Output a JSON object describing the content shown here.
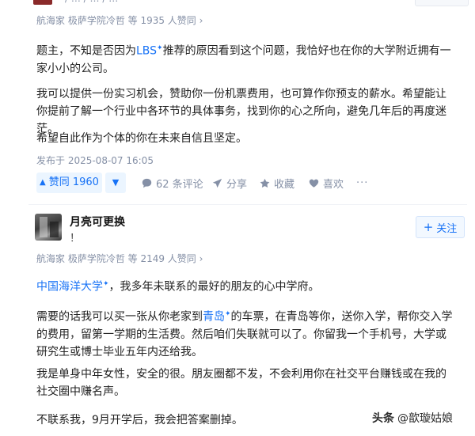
{
  "top_answer": {
    "meta_partial": "/ … / … / …",
    "author_meta": "航海家 极萨学院冷哲 等 1935 人赞同",
    "author_meta_arrow": "›",
    "para1_a": "题主，不知是否因为",
    "para1_link": "LBS",
    "para1_star": "✦",
    "para1_b": "推荐的原因看到这个问题，我恰好也在你的大学附近拥有一家小小的公司。",
    "para2": "我可以提供一份实习机会，赞助你一份机票费用，也可算作你预支的薪水。希望能让你提前了解一个行业中各环节的具体事务，找到你的心之所向，避免几年后的再度迷茫。",
    "para3": "希望自此作为个体的你在未来自信且坚定。",
    "posted": "发布于 2025-08-07 16:05",
    "actions": {
      "upvote_label": "赞同 1960",
      "upvote_icon": "triangle-up",
      "downvote_icon": "triangle-down",
      "comments": "62 条评论",
      "share": "分享",
      "favorite": "收藏",
      "like": "喜欢"
    }
  },
  "second_answer": {
    "author_name": "月亮可更换",
    "author_bio": "！",
    "follow_label": "关注",
    "follow_icon": "plus",
    "author_meta": "航海家 极萨学院冷哲 等 2149 人赞同",
    "author_meta_arrow": "›",
    "para1_link": "中国海洋大学",
    "para1_star": "✦",
    "para1_b": "，我多年未联系的最好的朋友的心中学府。",
    "para2_a": "需要的话我可以买一张从你老家到",
    "para2_link": "青岛",
    "para2_star": "✦",
    "para2_b": "的车票，在青岛等你，送你入学，帮你交入学的费用，留第一学期的生活费。然后咱们失联就可以了。你留我一个手机号，大学或研究生或博士毕业五年内还给我。",
    "para3": "我是单身中年女性，安全的很。朋友圈都不发，不会利用你在社交平台赚钱或在我的社交圈中赚名声。",
    "para4": "不联系我，9月开学后，我会把答案删掉。"
  },
  "watermark": {
    "logo": "头条",
    "handle": "@歆璇姑娘"
  },
  "colors": {
    "accent": "#1772f6",
    "muted": "#8590a6",
    "vote_bg": "#ebf5ff"
  }
}
